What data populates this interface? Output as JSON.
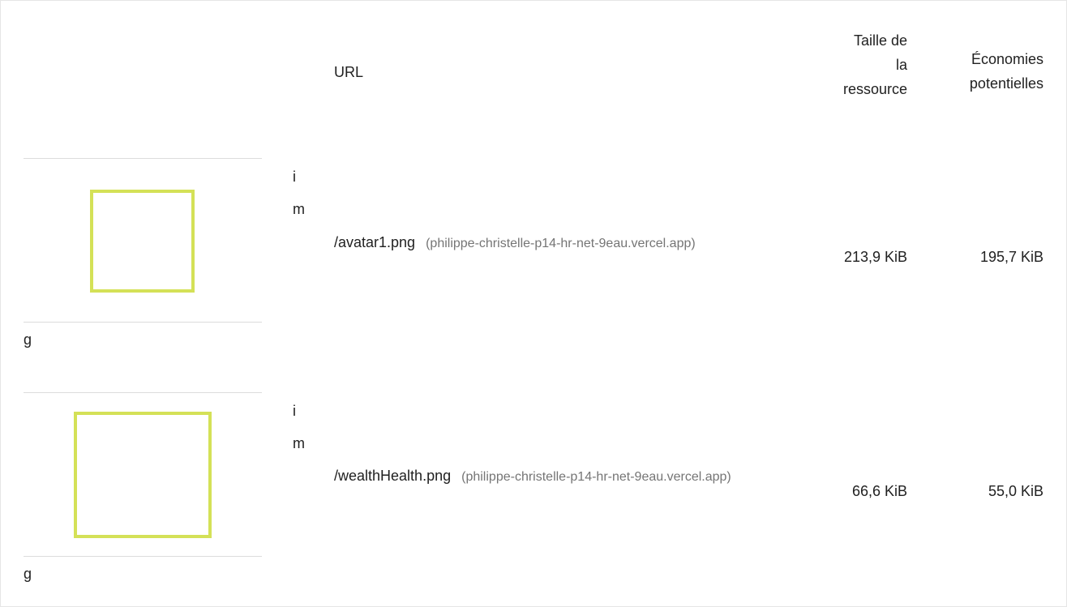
{
  "table": {
    "headers": {
      "url": "URL",
      "size_line1": "Taille de",
      "size_line2": "la",
      "size_line3": "ressource",
      "savings_line1": "Économies",
      "savings_line2": "potentielles"
    },
    "rows": [
      {
        "thumb_icon": "image-placeholder-icon",
        "type_letters": [
          "i",
          "m",
          "g"
        ],
        "path": "/avatar1.png",
        "host": "(philippe-christelle-p14-hr-net-9eau.vercel.app)",
        "size": "213,9 KiB",
        "savings": "195,7 KiB"
      },
      {
        "thumb_icon": "image-placeholder-icon",
        "type_letters": [
          "i",
          "m",
          "g"
        ],
        "path": "/wealthHealth.png",
        "host": "(philippe-christelle-p14-hr-net-9eau.vercel.app)",
        "size": "66,6 KiB",
        "savings": "55,0 KiB"
      }
    ]
  },
  "colors": {
    "thumb_outline": "#d4e157",
    "host_text": "#757575"
  }
}
